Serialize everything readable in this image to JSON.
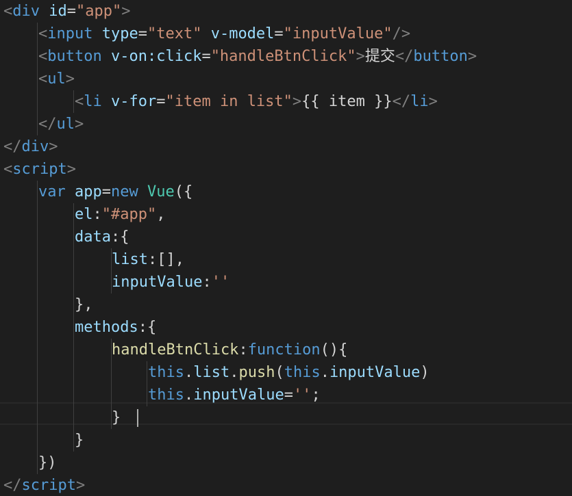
{
  "colors": {
    "background": "#1e1e1e",
    "bracket": "#808080",
    "tag": "#569cd6",
    "attribute": "#9cdcfe",
    "string": "#ce9178",
    "keyword": "#569cd6",
    "identifier": "#9cdcfe",
    "class": "#4ec9b0",
    "function": "#dcdcaa",
    "text": "#d4d4d4"
  },
  "editor": {
    "lines": [
      [
        {
          "t": "<",
          "c": "bracket"
        },
        {
          "t": "div",
          "c": "tag"
        },
        {
          "t": " ",
          "c": "text"
        },
        {
          "t": "id",
          "c": "attribute"
        },
        {
          "t": "=",
          "c": "text"
        },
        {
          "t": "\"app\"",
          "c": "string"
        },
        {
          "t": ">",
          "c": "bracket"
        }
      ],
      [
        {
          "t": "<",
          "c": "bracket"
        },
        {
          "t": "input",
          "c": "tag"
        },
        {
          "t": " ",
          "c": "text"
        },
        {
          "t": "type",
          "c": "attribute"
        },
        {
          "t": "=",
          "c": "text"
        },
        {
          "t": "\"text\"",
          "c": "string"
        },
        {
          "t": " ",
          "c": "text"
        },
        {
          "t": "v-model",
          "c": "attribute"
        },
        {
          "t": "=",
          "c": "text"
        },
        {
          "t": "\"inputValue\"",
          "c": "string"
        },
        {
          "t": "/>",
          "c": "bracket"
        }
      ],
      [
        {
          "t": "<",
          "c": "bracket"
        },
        {
          "t": "button",
          "c": "tag"
        },
        {
          "t": " ",
          "c": "text"
        },
        {
          "t": "v-on:click",
          "c": "attribute"
        },
        {
          "t": "=",
          "c": "text"
        },
        {
          "t": "\"handleBtnClick\"",
          "c": "string"
        },
        {
          "t": ">",
          "c": "bracket"
        },
        {
          "t": "提交",
          "c": "text"
        },
        {
          "t": "</",
          "c": "bracket"
        },
        {
          "t": "button",
          "c": "tag"
        },
        {
          "t": ">",
          "c": "bracket"
        }
      ],
      [
        {
          "t": "<",
          "c": "bracket"
        },
        {
          "t": "ul",
          "c": "tag"
        },
        {
          "t": ">",
          "c": "bracket"
        }
      ],
      [
        {
          "t": "<",
          "c": "bracket"
        },
        {
          "t": "li",
          "c": "tag"
        },
        {
          "t": " ",
          "c": "text"
        },
        {
          "t": "v-for",
          "c": "attribute"
        },
        {
          "t": "=",
          "c": "text"
        },
        {
          "t": "\"item in list\"",
          "c": "string"
        },
        {
          "t": ">",
          "c": "bracket"
        },
        {
          "t": "{{ item }}",
          "c": "text"
        },
        {
          "t": "</",
          "c": "bracket"
        },
        {
          "t": "li",
          "c": "tag"
        },
        {
          "t": ">",
          "c": "bracket"
        }
      ],
      [
        {
          "t": "</",
          "c": "bracket"
        },
        {
          "t": "ul",
          "c": "tag"
        },
        {
          "t": ">",
          "c": "bracket"
        }
      ],
      [
        {
          "t": "</",
          "c": "bracket"
        },
        {
          "t": "div",
          "c": "tag"
        },
        {
          "t": ">",
          "c": "bracket"
        }
      ],
      [
        {
          "t": "<",
          "c": "bracket"
        },
        {
          "t": "script",
          "c": "tag"
        },
        {
          "t": ">",
          "c": "bracket"
        }
      ],
      [
        {
          "t": "var",
          "c": "keyword"
        },
        {
          "t": " ",
          "c": "text"
        },
        {
          "t": "app",
          "c": "identifier"
        },
        {
          "t": "=",
          "c": "text"
        },
        {
          "t": "new",
          "c": "keyword"
        },
        {
          "t": " ",
          "c": "text"
        },
        {
          "t": "Vue",
          "c": "class"
        },
        {
          "t": "({",
          "c": "text"
        }
      ],
      [
        {
          "t": "el",
          "c": "identifier"
        },
        {
          "t": ":",
          "c": "text"
        },
        {
          "t": "\"#app\"",
          "c": "string"
        },
        {
          "t": ",",
          "c": "text"
        }
      ],
      [
        {
          "t": "data",
          "c": "identifier"
        },
        {
          "t": ":{",
          "c": "text"
        }
      ],
      [
        {
          "t": "list",
          "c": "identifier"
        },
        {
          "t": ":[],",
          "c": "text"
        }
      ],
      [
        {
          "t": "inputValue",
          "c": "identifier"
        },
        {
          "t": ":",
          "c": "text"
        },
        {
          "t": "''",
          "c": "string"
        }
      ],
      [
        {
          "t": "},",
          "c": "text"
        }
      ],
      [
        {
          "t": "methods",
          "c": "identifier"
        },
        {
          "t": ":{",
          "c": "text"
        }
      ],
      [
        {
          "t": "handleBtnClick",
          "c": "function"
        },
        {
          "t": ":",
          "c": "text"
        },
        {
          "t": "function",
          "c": "keyword"
        },
        {
          "t": "(){",
          "c": "text"
        }
      ],
      [
        {
          "t": "this",
          "c": "keyword"
        },
        {
          "t": ".",
          "c": "text"
        },
        {
          "t": "list",
          "c": "identifier"
        },
        {
          "t": ".",
          "c": "text"
        },
        {
          "t": "push",
          "c": "function"
        },
        {
          "t": "(",
          "c": "text"
        },
        {
          "t": "this",
          "c": "keyword"
        },
        {
          "t": ".",
          "c": "text"
        },
        {
          "t": "inputValue",
          "c": "identifier"
        },
        {
          "t": ")",
          "c": "text"
        }
      ],
      [
        {
          "t": "this",
          "c": "keyword"
        },
        {
          "t": ".",
          "c": "text"
        },
        {
          "t": "inputValue",
          "c": "identifier"
        },
        {
          "t": "=",
          "c": "text"
        },
        {
          "t": "''",
          "c": "string"
        },
        {
          "t": ";",
          "c": "text"
        }
      ],
      [
        {
          "t": "}",
          "c": "text"
        }
      ],
      [
        {
          "t": "}",
          "c": "text"
        }
      ],
      [
        {
          "t": "})",
          "c": "text"
        }
      ],
      [
        {
          "t": "</",
          "c": "bracket"
        },
        {
          "t": "script",
          "c": "tag"
        },
        {
          "t": ">",
          "c": "bracket"
        }
      ]
    ]
  }
}
